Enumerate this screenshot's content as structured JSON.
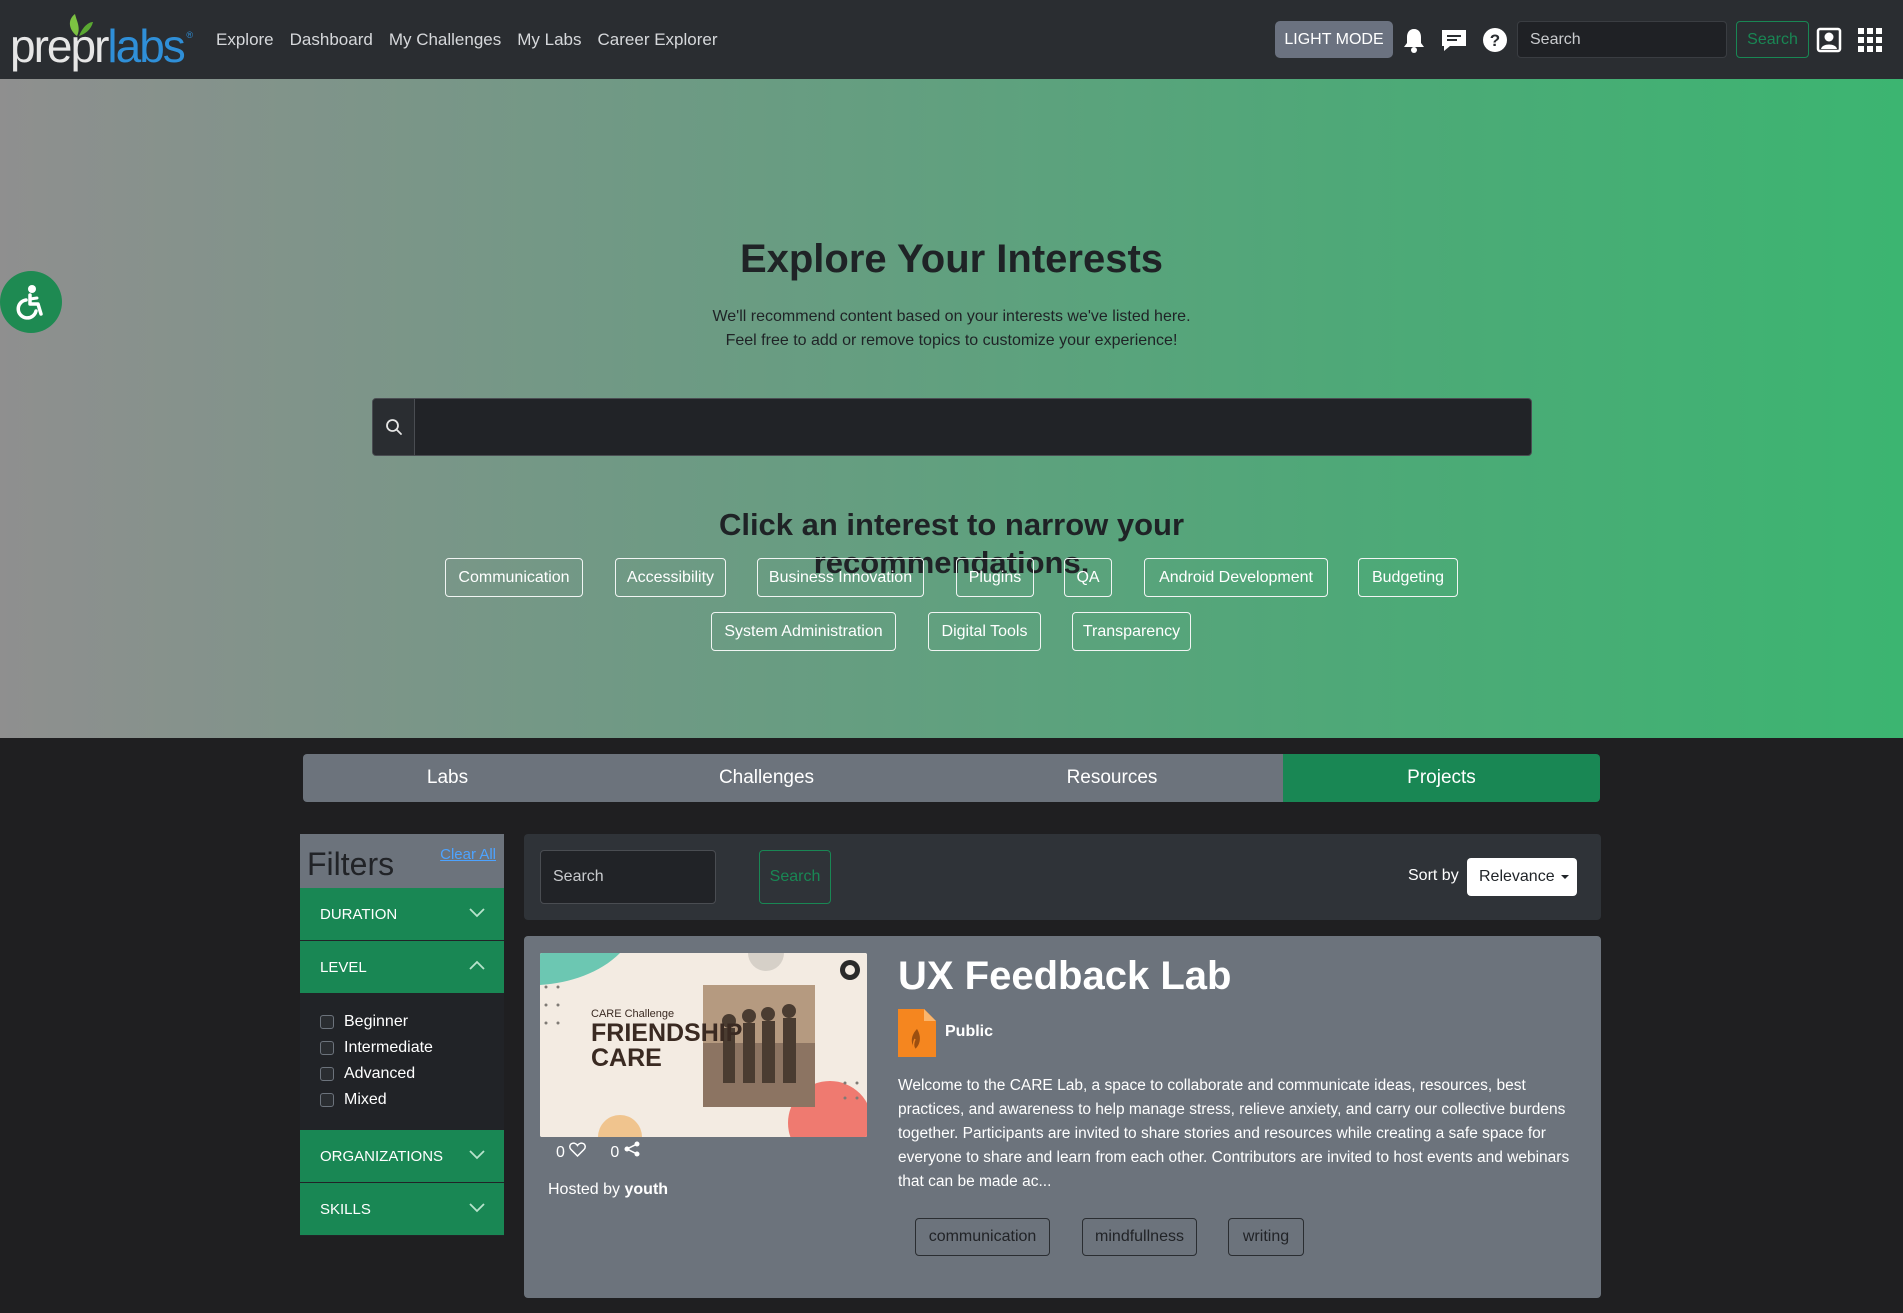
{
  "nav": {
    "logo": "preprlabs",
    "links": [
      "Explore",
      "Dashboard",
      "My Challenges",
      "My Labs",
      "Career Explorer"
    ],
    "light_mode": "LIGHT MODE",
    "search_placeholder": "Search",
    "search_button": "Search"
  },
  "hero": {
    "title": "Explore Your Interests",
    "subtitle_line1": "We'll recommend content based on your interests we've listed here.",
    "subtitle_line2": "Feel free to add or remove topics to customize your experience!",
    "prompt_line1": "Click an interest to narrow your",
    "prompt_line2": "recommendations.",
    "interests": [
      "Communication",
      "Accessibility",
      "Business Innovation",
      "Plugins",
      "QA",
      "Android Development",
      "Budgeting",
      "System Administration",
      "Digital Tools",
      "Transparency"
    ]
  },
  "tabs": [
    "Labs",
    "Challenges",
    "Resources",
    "Projects"
  ],
  "active_tab": "Projects",
  "filters": {
    "title": "Filters",
    "clear_all": "Clear All",
    "facets": [
      "DURATION",
      "LEVEL",
      "ORGANIZATIONS",
      "SKILLS"
    ],
    "level_options": [
      "Beginner",
      "Intermediate",
      "Advanced",
      "Mixed"
    ]
  },
  "results": {
    "search_placeholder": "Search",
    "search_button": "Search",
    "sort_label": "Sort by",
    "sort_value": "Relevance"
  },
  "card": {
    "title": "UX Feedback Lab",
    "visibility": "Public",
    "thumb_caption": "CARE Challenge",
    "thumb_title_1": "FRIENDSHIP",
    "thumb_title_2": "CARE",
    "description": "Welcome to the CARE Lab, a space to collaborate and communicate ideas, resources, best practices, and awareness to help manage stress, relieve anxiety, and carry our collective burdens together. Participants are invited to share stories and resources while creating a safe space for everyone to share and learn from each other. Contributors are invited to host events and webinars that can be made ac...",
    "likes": "0",
    "shares": "0",
    "hosted_by_label": "Hosted by",
    "host": "youth",
    "tags": [
      "communication",
      "mindfullness",
      "writing"
    ]
  },
  "colors": {
    "accent": "#198754",
    "navbar": "#2a2d31",
    "tab_inactive": "#6c737c",
    "card_bg": "#6c737c"
  }
}
